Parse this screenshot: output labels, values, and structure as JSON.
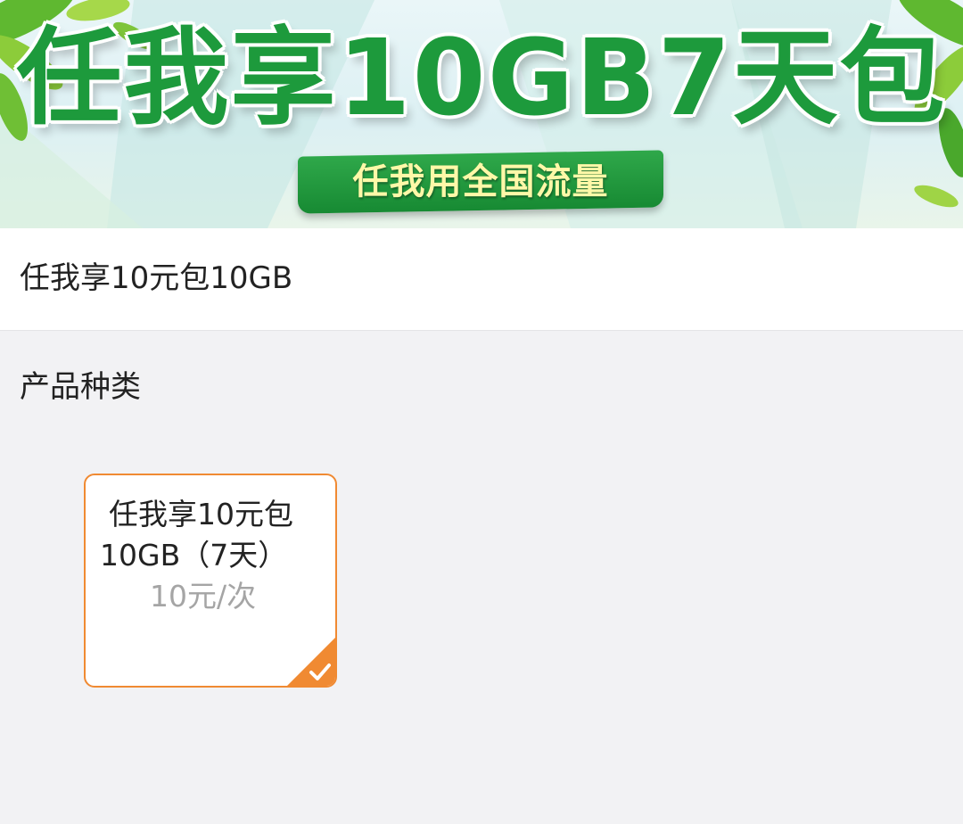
{
  "banner": {
    "title": "任我享10GB7天包",
    "ribbon": "任我用全国流量"
  },
  "product": {
    "name": "任我享10元包10GB"
  },
  "section": {
    "label": "产品种类"
  },
  "option": {
    "line1": "任我享10元包",
    "line2": "10GB（7天）",
    "price": "10元/次",
    "selected": true,
    "icon": "check-icon"
  },
  "colors": {
    "accent": "#f08a32",
    "banner_green": "#1d9a3c",
    "ribbon_text": "#fff8a8",
    "price_gray": "#a5a5a5"
  }
}
